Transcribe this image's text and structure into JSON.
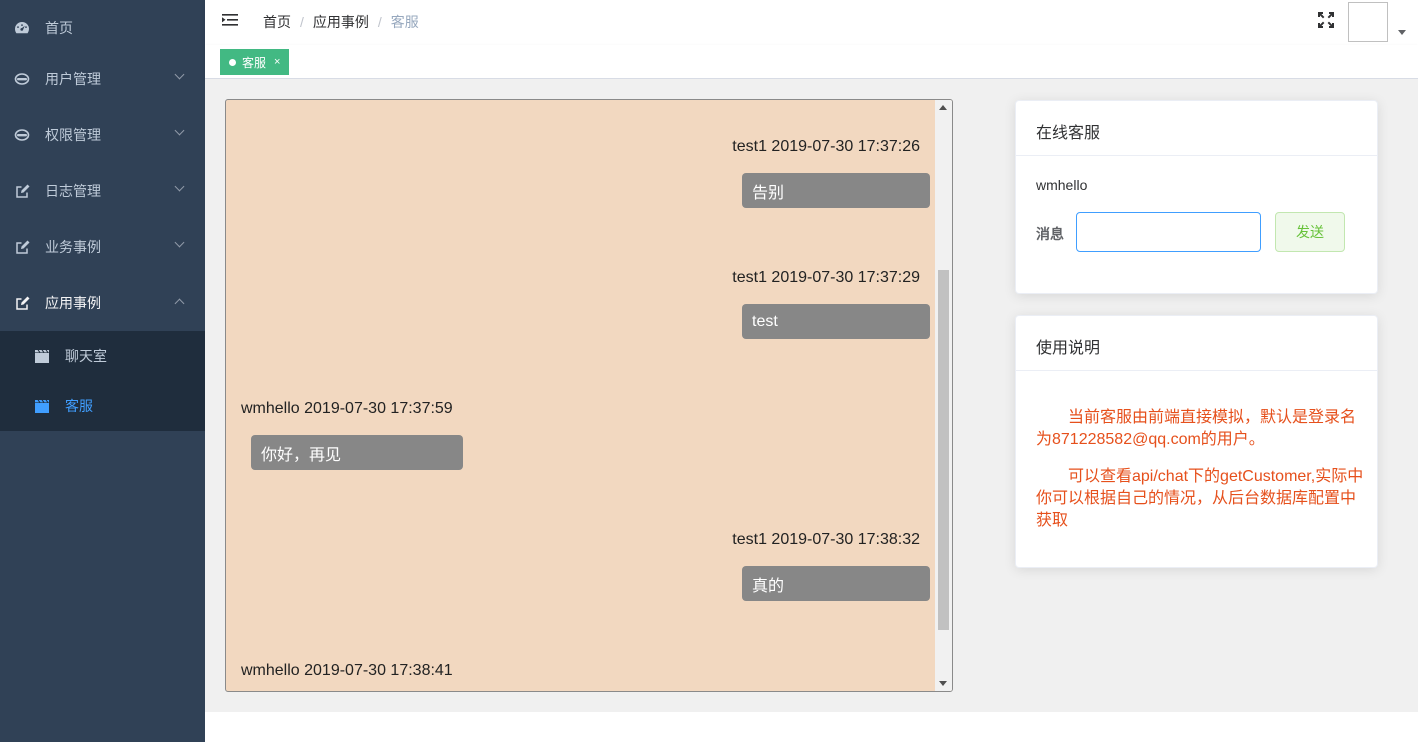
{
  "sidebar": {
    "items": [
      {
        "label": "首页",
        "icon": "dashboard-icon"
      },
      {
        "label": "用户管理",
        "icon": "user-icon"
      },
      {
        "label": "权限管理",
        "icon": "permission-icon"
      },
      {
        "label": "日志管理",
        "icon": "edit-icon"
      },
      {
        "label": "业务事例",
        "icon": "edit-icon"
      },
      {
        "label": "应用事例",
        "icon": "edit-icon"
      }
    ],
    "submenu": [
      {
        "label": "聊天室",
        "icon": "clapperboard-icon"
      },
      {
        "label": "客服",
        "icon": "clapperboard-icon"
      }
    ]
  },
  "breadcrumb": {
    "items": [
      "首页",
      "应用事例"
    ],
    "separator": "/",
    "current": "客服"
  },
  "tags": [
    {
      "label": "客服",
      "close": "×"
    }
  ],
  "chat": {
    "messages": [
      {
        "meta": "test1 2019-07-30 17:37:26",
        "text": "告别",
        "side": "right"
      },
      {
        "meta": "test1 2019-07-30 17:37:29",
        "text": "test",
        "side": "right"
      },
      {
        "meta": "wmhello 2019-07-30 17:37:59",
        "text": "你好，再见",
        "side": "left"
      },
      {
        "meta": "test1 2019-07-30 17:38:32",
        "text": "真的",
        "side": "right"
      },
      {
        "meta": "wmhello 2019-07-30 17:38:41",
        "text": "",
        "side": "left"
      }
    ]
  },
  "online_service": {
    "title": "在线客服",
    "user": "wmhello",
    "message_label": "消息",
    "message_value": "",
    "send_label": "发送"
  },
  "instructions": {
    "title": "使用说明",
    "paragraphs": [
      "当前客服由前端直接模拟，默认是登录名为871228582@qq.com的用户。",
      "可以查看api/chat下的getCustomer,实际中你可以根据自己的情况，从后台数据库配置中获取"
    ]
  },
  "colors": {
    "sidebar_bg": "#304156",
    "active": "#409eff",
    "tag": "#42b983",
    "instruction_text": "#e6501c",
    "chat_bg": "#f2d8c0",
    "bubble": "#878787"
  }
}
